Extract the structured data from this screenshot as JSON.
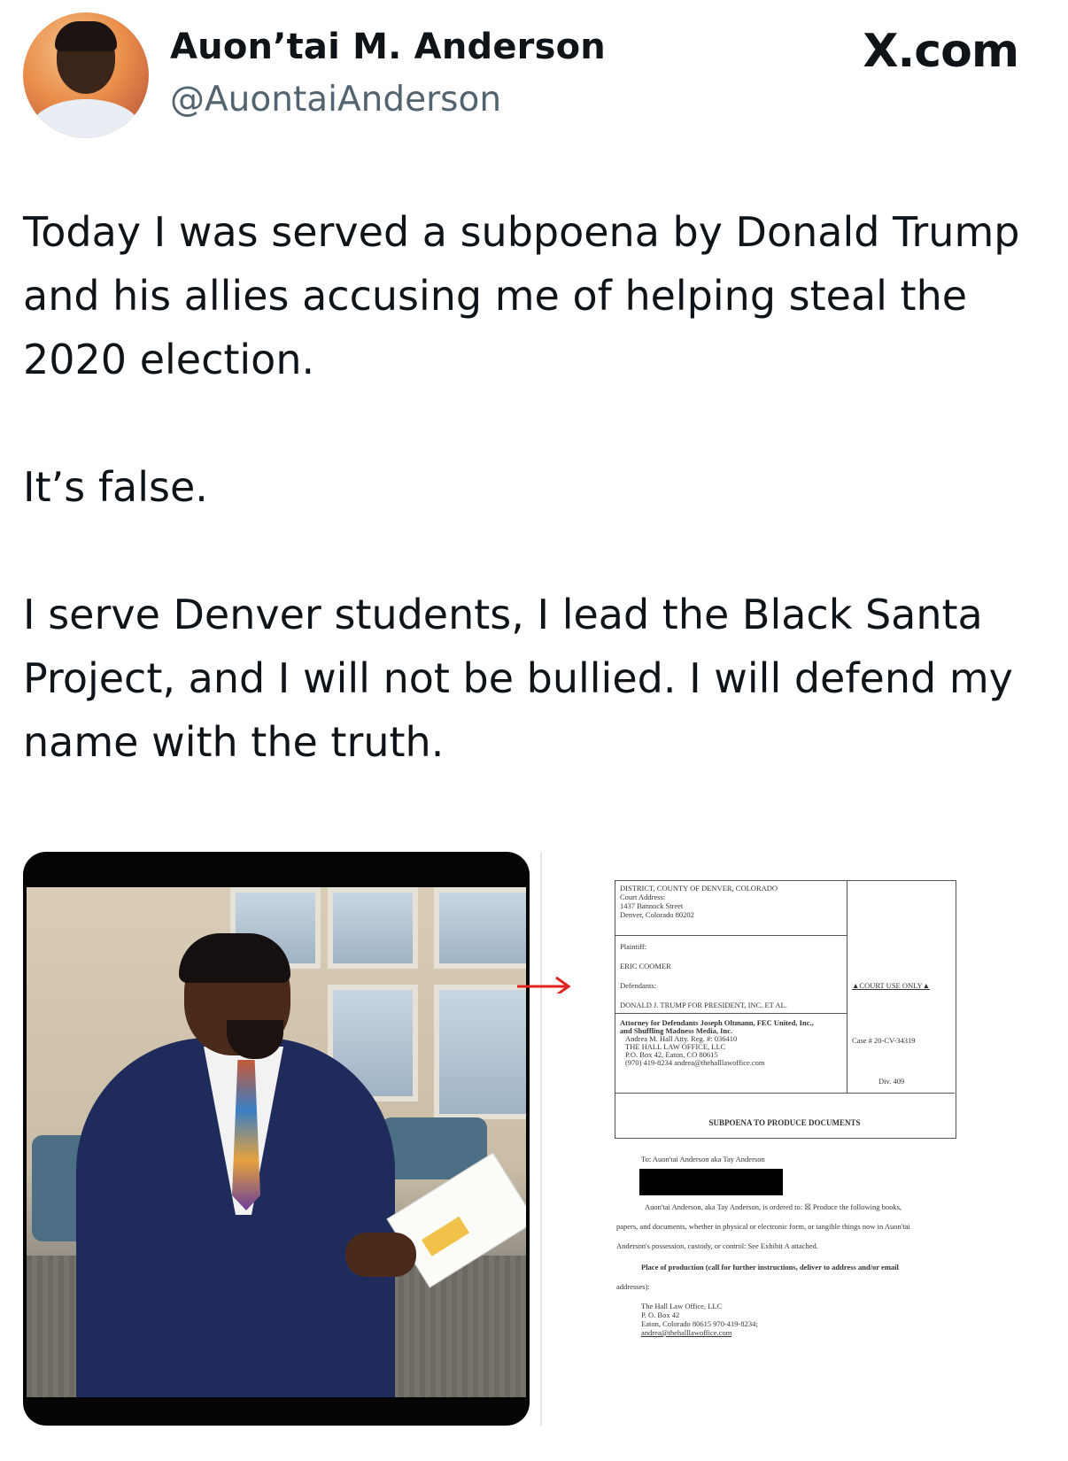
{
  "header": {
    "name": "Auon’tai M. Anderson",
    "handle": "@AuontaiAnderson",
    "brand": "X.com"
  },
  "tweet": {
    "paragraphs": [
      "Today I was served a subpoena by Donald Trump and his allies accusing me of helping steal the 2020 election.",
      "It’s false.",
      "I serve Denver students, I lead the Black Santa Project, and I will not be bullied. I will defend my name with the truth."
    ]
  },
  "media": {
    "photo_desc_icon": "person-photo",
    "document": {
      "court_lines": [
        "DISTRICT, COUNTY OF DENVER, COLORADO",
        "Court Address:",
        "1437 Bannock Street",
        "Denver, Colorado 80202"
      ],
      "plaintiff_label": "Plaintiff:",
      "plaintiff": "ERIC COOMER",
      "defendants_label": "Defendants:",
      "defendants": "DONALD J. TRUMP FOR PRESIDENT, INC. ET AL.",
      "court_use": "▲COURT USE ONLY▲",
      "attorney_lines": [
        "Attorney for Defendants Joseph Oltmann, FEC United, Inc.,",
        "and Shuffling Madness Media, Inc.",
        "Andrea M. Hall   Atty. Reg. #: 036410",
        "THE HALL LAW OFFICE, LLC",
        "P.O. Box 42, Eaton, CO 80615",
        "(970) 419-8234  andrea@thehalllawoffice.com"
      ],
      "case_no": "Case # 20-CV-34319",
      "div": "Div. 409",
      "title": "SUBPOENA TO PRODUCE DOCUMENTS",
      "to_line": "To: Auon'tai Anderson aka Tay Anderson",
      "body_lines": [
        "Auon'tai Anderson, aka Tay Anderson, is ordered to: ☒ Produce the following books,",
        "papers, and documents, whether in physical or electronic form, or tangible things now in Auon'tai",
        "Anderson's possession, custody, or control: See Exhibit A attached."
      ],
      "place_lines": [
        "Place of production (call for further instructions, deliver to address and/or email",
        "addresses):"
      ],
      "address_lines": [
        "The Hall Law Office, LLC",
        "P. O. Box 42",
        "Eaton, Colorado 80615 970-419-8234;",
        "andrea@thehalllawoffice.com"
      ]
    }
  }
}
